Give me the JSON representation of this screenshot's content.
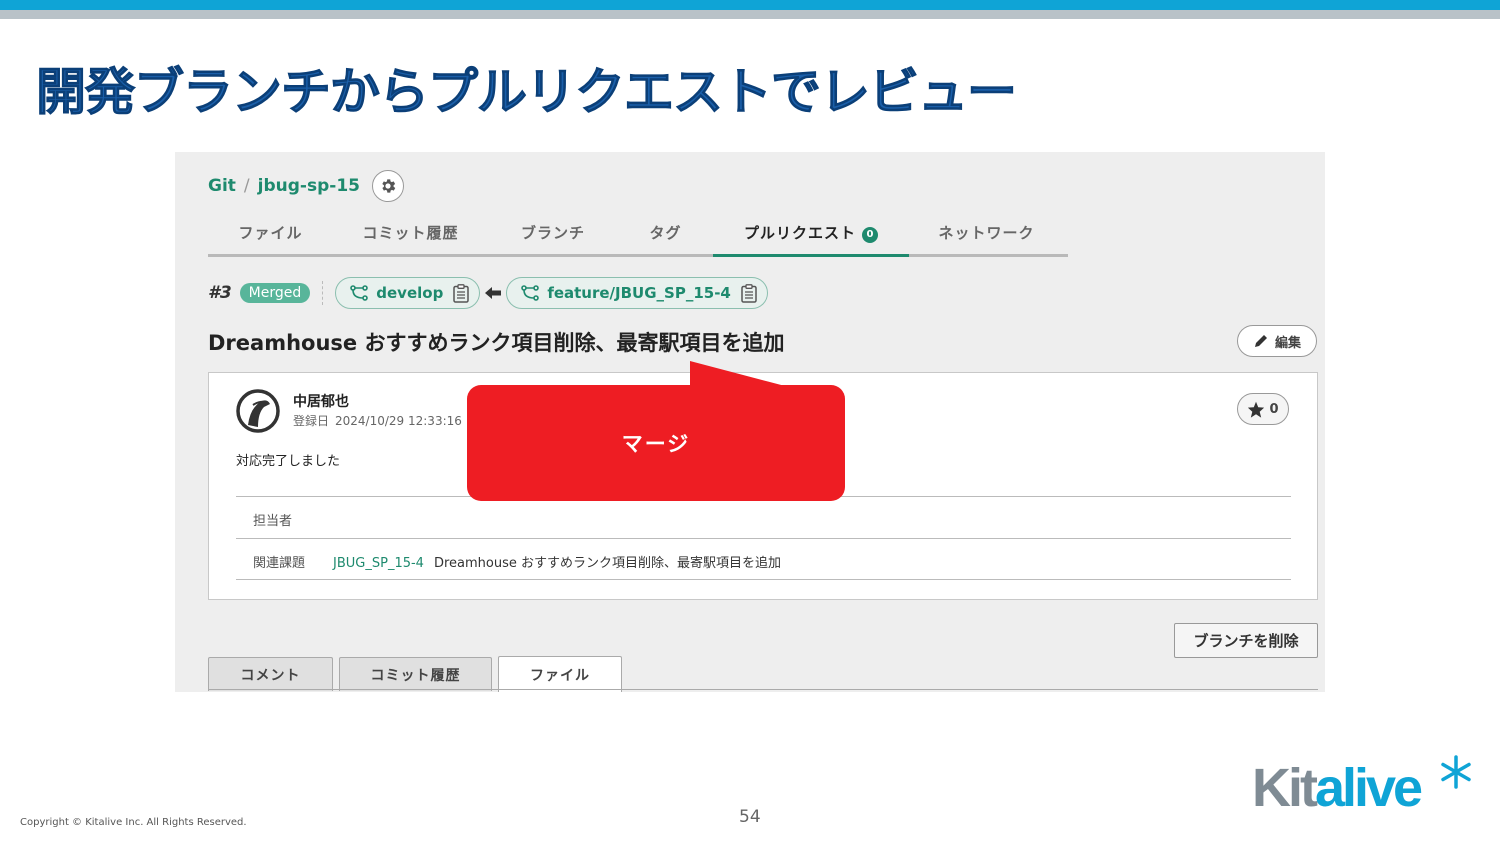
{
  "slide": {
    "title": "開発ブランチからプルリクエストでレビュー",
    "copyright": "Copyright © Kitalive Inc. All Rights Reserved.",
    "page_number": "54",
    "logo": {
      "part1": "Kit",
      "part2": "alive"
    }
  },
  "breadcrumb": {
    "root": "Git",
    "separator": "/",
    "repo": "jbug-sp-15"
  },
  "tabs": [
    {
      "label": "ファイル"
    },
    {
      "label": "コミット履歴"
    },
    {
      "label": "ブランチ"
    },
    {
      "label": "タグ"
    },
    {
      "label": "プルリクエスト",
      "count": "0",
      "active": true
    },
    {
      "label": "ネットワーク"
    }
  ],
  "pull_request": {
    "number": "#3",
    "status": "Merged",
    "base_branch": "develop",
    "head_branch": "feature/JBUG_SP_15-4",
    "title": "Dreamhouse おすすめランク項目削除、最寄駅項目を追加",
    "edit_label": "編集",
    "author": "中居郁也",
    "registered_label": "登録日",
    "registered_at": "2024/10/29 12:33:16",
    "star_count": "0",
    "body": "対応完了しました",
    "assignee_label": "担当者",
    "related_label": "関連課題",
    "related_issue_key": "JBUG_SP_15-4",
    "related_issue_title": "Dreamhouse おすすめランク項目削除、最寄駅項目を追加",
    "delete_branch_label": "ブランチを削除"
  },
  "bottom_tabs": [
    {
      "label": "コメント"
    },
    {
      "label": "コミット履歴"
    },
    {
      "label": "ファイル",
      "active": true
    }
  ],
  "callout": {
    "text": "マージ",
    "color": "#ee1d23"
  },
  "colors": {
    "accent": "#1e8a6e",
    "title_blue": "#1b5fa9",
    "top_bar": "#0fa4d6"
  }
}
